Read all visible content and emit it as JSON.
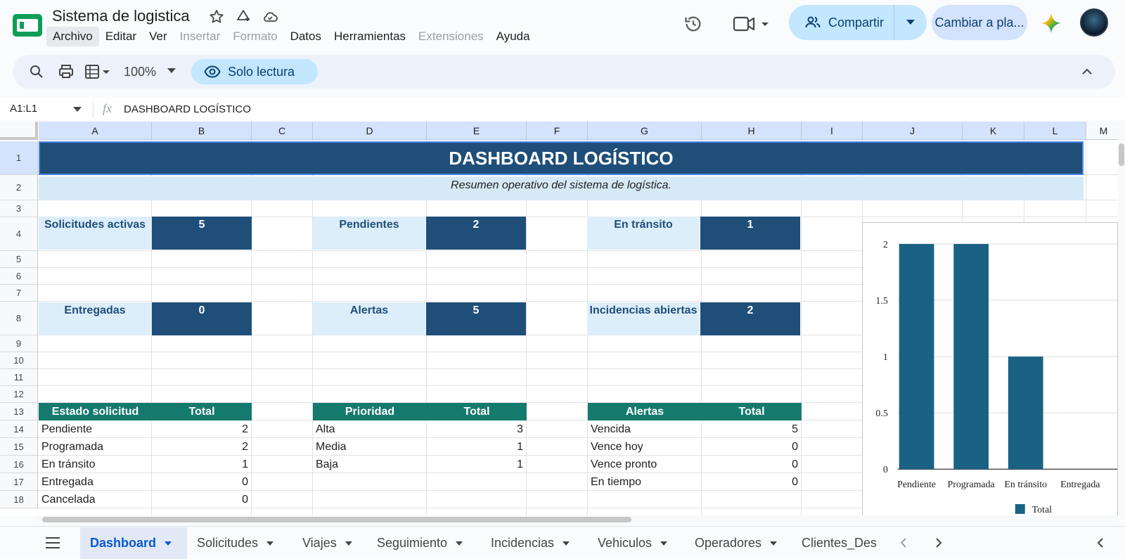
{
  "app": {
    "title": "Sistema de logistica"
  },
  "menu": [
    "Archivo",
    "Editar",
    "Ver",
    "Insertar",
    "Formato",
    "Datos",
    "Herramientas",
    "Extensiones",
    "Ayuda"
  ],
  "header": {
    "share_label": "Compartir",
    "switch_label": "Cambiar a pla..."
  },
  "toolbar": {
    "zoom": "100%",
    "mode_label": "Solo lectura"
  },
  "formula_bar": {
    "cell_ref": "A1:L1",
    "fx": "fx",
    "value": "DASHBOARD LOGÍSTICO"
  },
  "columns": [
    "A",
    "B",
    "C",
    "D",
    "E",
    "F",
    "G",
    "H",
    "I",
    "J",
    "K",
    "L",
    "M"
  ],
  "rows": [
    "1",
    "2",
    "3",
    "4",
    "5",
    "6",
    "7",
    "8",
    "9",
    "10",
    "11",
    "12",
    "13",
    "14",
    "15",
    "16",
    "17",
    "18"
  ],
  "dashboard": {
    "title": "DASHBOARD LOGÍSTICO",
    "subtitle": "Resumen operativo del sistema de logística.",
    "kpis": [
      {
        "label": "Solicitudes activas",
        "value": "5"
      },
      {
        "label": "Pendientes",
        "value": "2"
      },
      {
        "label": "En tránsito",
        "value": "1"
      },
      {
        "label": "Entregadas",
        "value": "0"
      },
      {
        "label": "Alertas",
        "value": "5"
      },
      {
        "label": "Incidencias abiertas",
        "value": "2"
      }
    ],
    "tables": [
      {
        "headers": [
          "Estado solicitud",
          "Total"
        ],
        "rows": [
          [
            "Pendiente",
            "2"
          ],
          [
            "Programada",
            "2"
          ],
          [
            "En tránsito",
            "1"
          ],
          [
            "Entregada",
            "0"
          ],
          [
            "Cancelada",
            "0"
          ]
        ]
      },
      {
        "headers": [
          "Prioridad",
          "Total"
        ],
        "rows": [
          [
            "Alta",
            "3"
          ],
          [
            "Media",
            "1"
          ],
          [
            "Baja",
            "1"
          ]
        ]
      },
      {
        "headers": [
          "Alertas",
          "Total"
        ],
        "rows": [
          [
            "Vencida",
            "5"
          ],
          [
            "Vence hoy",
            "0"
          ],
          [
            "Vence pronto",
            "0"
          ],
          [
            "En tiempo",
            "0"
          ]
        ]
      }
    ]
  },
  "chart_data": {
    "type": "bar",
    "categories": [
      "Pendiente",
      "Programada",
      "En tránsito",
      "Entregada"
    ],
    "series": [
      {
        "name": "Total",
        "values": [
          2,
          2,
          1,
          0
        ],
        "color": "#1a6283"
      }
    ],
    "ylim": [
      0,
      2
    ],
    "yticks": [
      "0",
      "0.5",
      "1",
      "1.5",
      "2"
    ],
    "legend": "bottom",
    "grid": true
  },
  "sheet_tabs": [
    "Dashboard",
    "Solicitudes",
    "Viajes",
    "Seguimiento",
    "Incidencias",
    "Vehiculos",
    "Operadores",
    "Clientes_Des"
  ],
  "active_tab": "Dashboard",
  "colors": {
    "title_fill": "#1f4e79",
    "table_header": "#157a6e",
    "kpi_label_fill": "#ddeefb",
    "accent": "#0b57d0"
  }
}
